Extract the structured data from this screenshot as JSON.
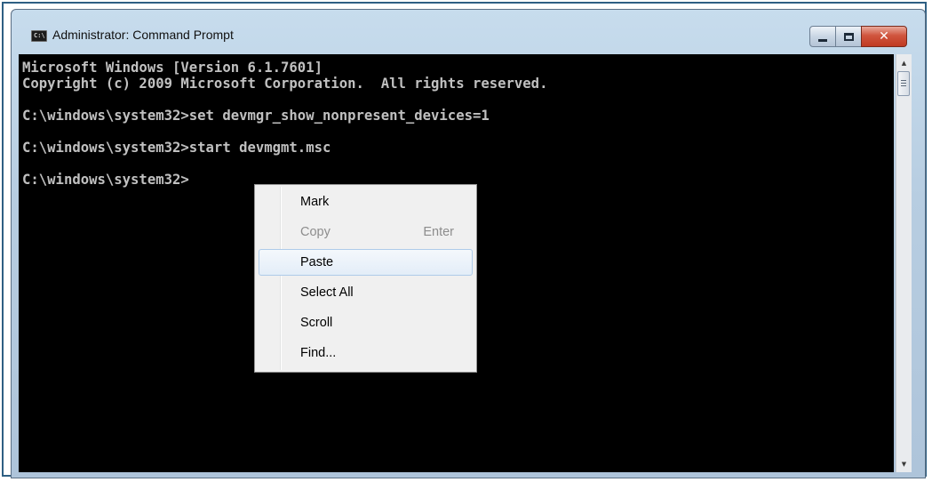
{
  "window": {
    "title": "Administrator: Command Prompt",
    "icon_text": "C:\\"
  },
  "caption_buttons": {
    "minimize": "minimize-icon",
    "maximize": "maximize-icon",
    "close": "✕"
  },
  "console": {
    "lines": [
      "Microsoft Windows [Version 6.1.7601]",
      "Copyright (c) 2009 Microsoft Corporation.  All rights reserved.",
      "C:\\windows\\system32>set devmgr_show_nonpresent_devices=1",
      "C:\\windows\\system32>start devmgmt.msc",
      "C:\\windows\\system32>"
    ]
  },
  "context_menu": {
    "items": [
      {
        "label": "Mark",
        "shortcut": "",
        "disabled": false,
        "highlighted": false
      },
      {
        "label": "Copy",
        "shortcut": "Enter",
        "disabled": true,
        "highlighted": false
      },
      {
        "label": "Paste",
        "shortcut": "",
        "disabled": false,
        "highlighted": true
      },
      {
        "label": "Select All",
        "shortcut": "",
        "disabled": false,
        "highlighted": false
      },
      {
        "label": "Scroll",
        "shortcut": "",
        "disabled": false,
        "highlighted": false
      },
      {
        "label": "Find...",
        "shortcut": "",
        "disabled": false,
        "highlighted": false
      }
    ]
  },
  "colors": {
    "console_bg": "#000000",
    "console_text": "#c0c0c0",
    "menu_highlight_border": "#aecbe9",
    "close_button": "#c03a22"
  }
}
